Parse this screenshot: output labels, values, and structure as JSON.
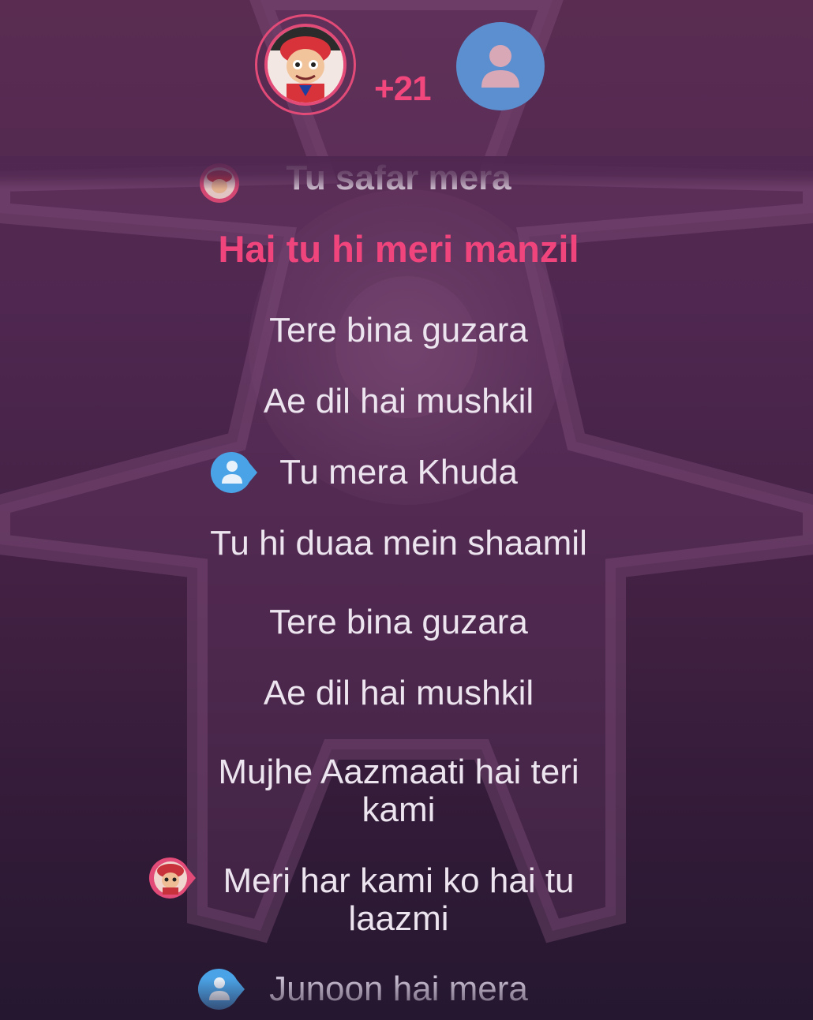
{
  "colors": {
    "background_top": "#5a2c52",
    "background_bottom": "#261730",
    "accent_pink": "#f0447d",
    "duet_blue": "#5b8fd0",
    "lyric_text": "#ece4ee"
  },
  "header": {
    "singer_avatar_icon": "cartoon-character-avatar",
    "participant_count": "+21",
    "duet_avatar_icon": "person-placeholder-icon"
  },
  "lyrics": [
    {
      "text": "Tu safar mera",
      "state": "previous",
      "marker": "singer"
    },
    {
      "text": "Hai tu hi meri manzil",
      "state": "active",
      "marker": null
    },
    {
      "text": "Tere bina guzara",
      "state": "upcoming",
      "marker": null
    },
    {
      "text": "Ae dil hai mushkil",
      "state": "upcoming",
      "marker": null
    },
    {
      "text": "Tu mera Khuda",
      "state": "upcoming",
      "marker": "duet"
    },
    {
      "text": "Tu hi duaa mein shaamil",
      "state": "upcoming",
      "marker": null
    },
    {
      "text": "Tere bina guzara",
      "state": "upcoming",
      "marker": null
    },
    {
      "text": "Ae dil hai mushkil",
      "state": "upcoming",
      "marker": null
    },
    {
      "text": "Mujhe Aazmaati hai teri",
      "text2": "kami",
      "state": "upcoming",
      "marker": null
    },
    {
      "text": "Meri har kami ko hai tu",
      "text2": "laazmi",
      "state": "upcoming",
      "marker": "singer"
    },
    {
      "text": "Junoon hai mera",
      "state": "upcoming",
      "marker": "duet"
    }
  ]
}
